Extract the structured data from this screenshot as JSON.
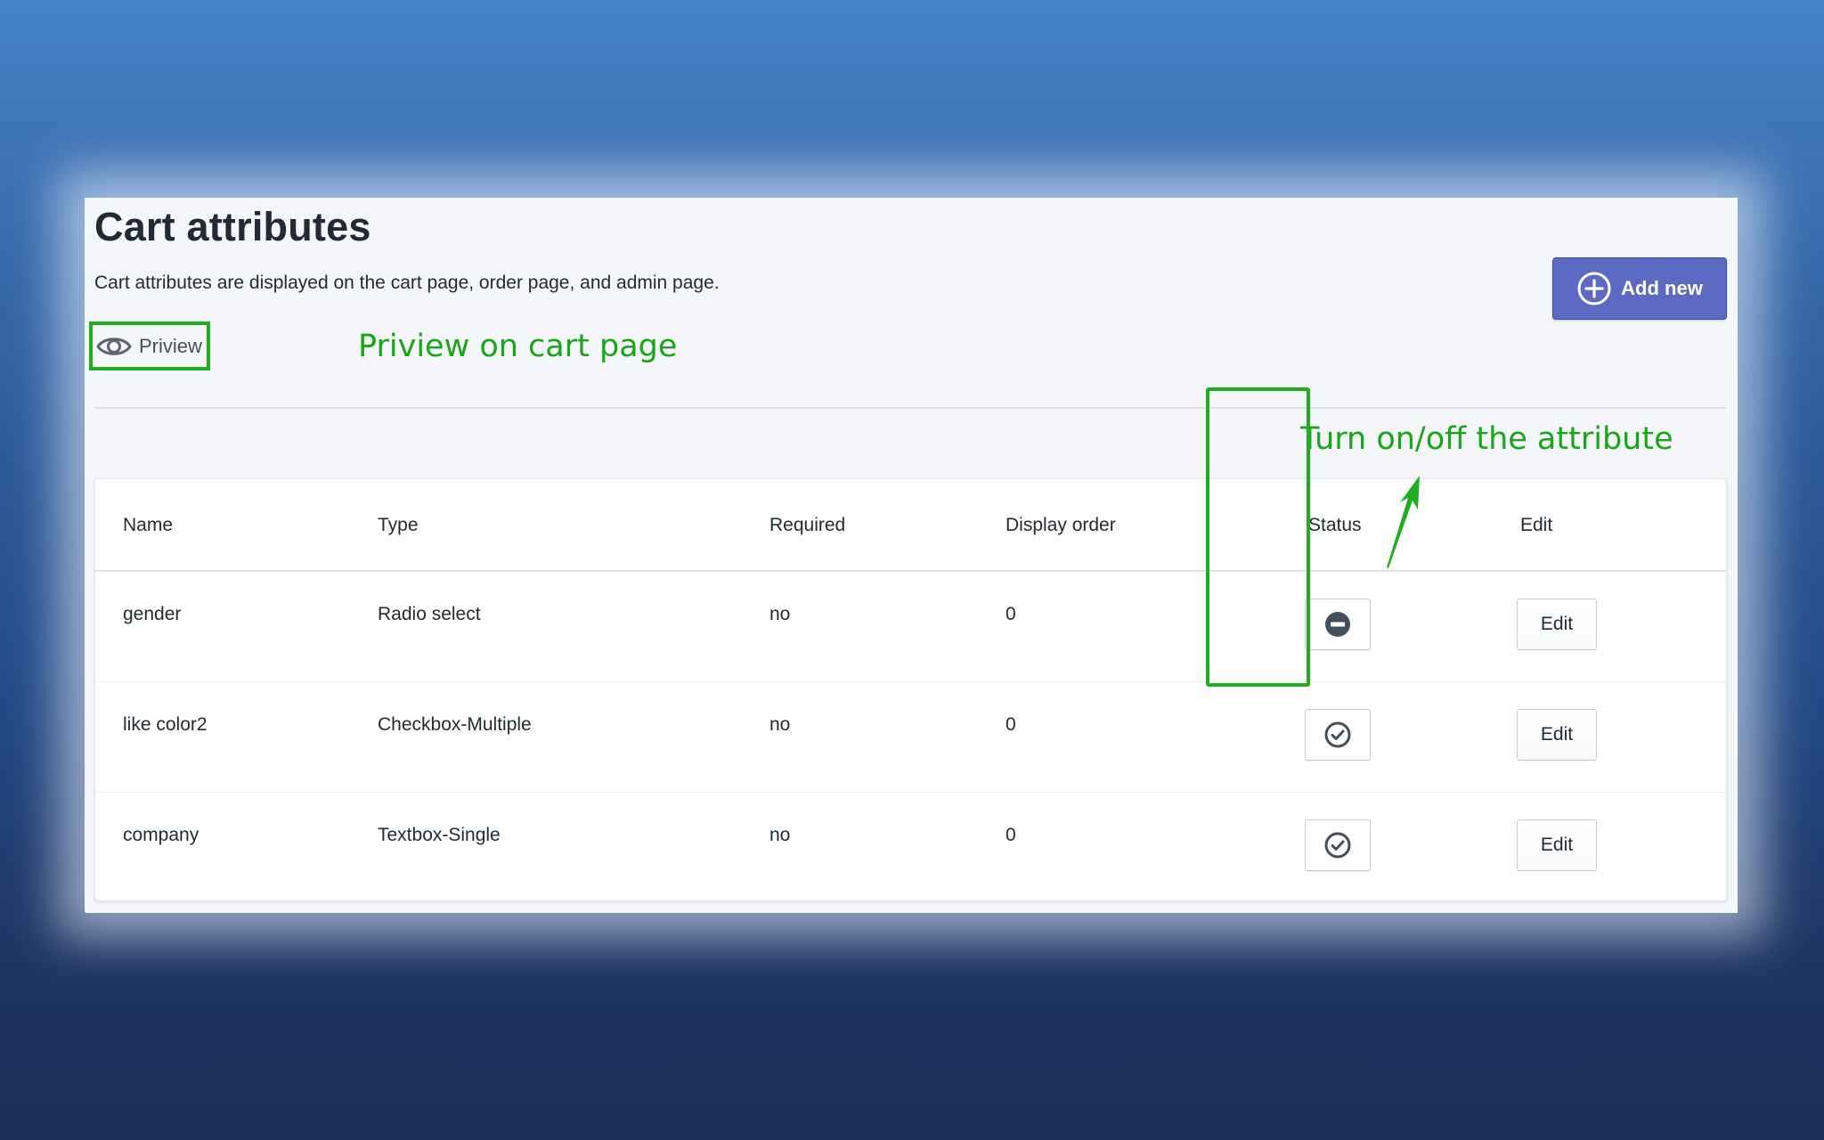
{
  "page": {
    "title": "Cart attributes",
    "description": "Cart attributes are displayed on the cart page, order page, and admin page.",
    "add_new_label": "Add new",
    "preview_label": "Priview"
  },
  "annotations": {
    "preview_note": "Priview on cart page",
    "status_note": "Turn on/off the attribute",
    "highlight_color": "#1fae1f"
  },
  "table": {
    "headers": {
      "name": "Name",
      "type": "Type",
      "required": "Required",
      "display_order": "Display order",
      "status": "Status",
      "edit": "Edit"
    },
    "rows": [
      {
        "name": "gender",
        "type": "Radio select",
        "required": "no",
        "display_order": "0",
        "status": "disabled",
        "status_icon": "minus-circle-icon",
        "edit_label": "Edit"
      },
      {
        "name": "like color2",
        "type": "Checkbox-Multiple",
        "required": "no",
        "display_order": "0",
        "status": "enabled",
        "status_icon": "check-circle-icon",
        "edit_label": "Edit"
      },
      {
        "name": "company",
        "type": "Textbox-Single",
        "required": "no",
        "display_order": "0",
        "status": "enabled",
        "status_icon": "check-circle-icon",
        "edit_label": "Edit"
      }
    ]
  },
  "colors": {
    "primary_button": "#5c6ac4",
    "annotation_green": "#19a619",
    "text": "#212b36",
    "icon": "#454f5b"
  }
}
